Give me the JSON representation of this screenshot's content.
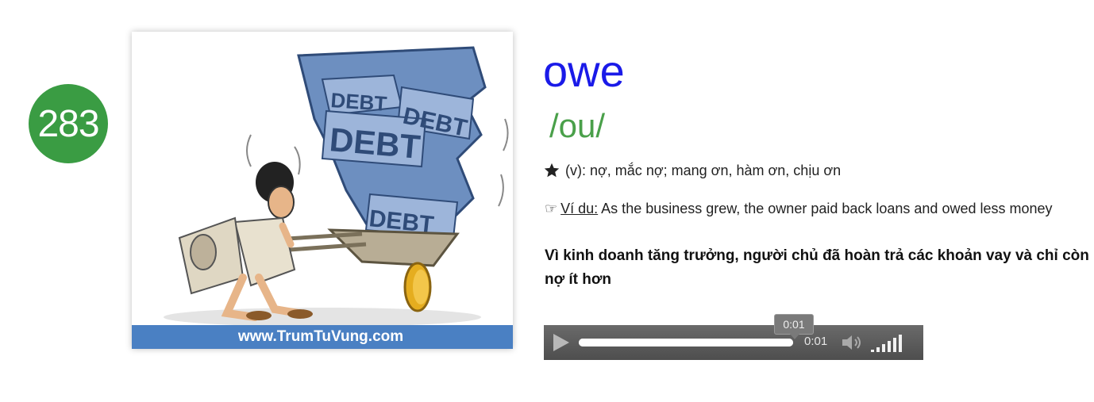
{
  "card": {
    "number": "283",
    "image_text": [
      "DEBT",
      "DEBT",
      "DEBT",
      "DEBT"
    ],
    "website": "www.TrumTuVung.com"
  },
  "entry": {
    "word": "owe",
    "phonetic": "/ou/",
    "meaning": "(v): nợ, mắc nợ; mang ơn, hàm ơn, chịu ơn",
    "example_label": "Ví du:",
    "example_text": " As the business grew, the owner paid back loans and owed less money",
    "translation": "Vì kinh doanh tăng trưởng, người chủ đã hoàn trả các khoản vay và chỉ còn nợ ít hơn"
  },
  "player": {
    "current_time": "0:01",
    "tooltip_time": "0:01",
    "progress": 1.0,
    "volume_level_bars": 6
  },
  "colors": {
    "badge": "#3a9c43",
    "word": "#1a1ae8",
    "phonetic": "#4aa04a",
    "footer": "#4a80c3",
    "player": "#5b5b5b"
  },
  "icons": {
    "meaning": "star-icon",
    "example": "pointing-hand-icon",
    "play": "play-icon",
    "volume": "speaker-icon"
  }
}
